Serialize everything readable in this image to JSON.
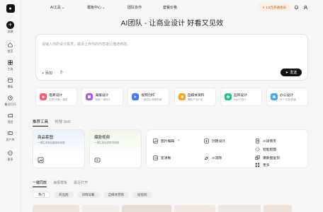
{
  "sidebar": {
    "create_label": "创建",
    "items": [
      {
        "label": "首页",
        "icon": "home-icon",
        "active": true
      },
      {
        "label": "工具",
        "icon": "tools-icon"
      },
      {
        "label": "模板",
        "icon": "template-icon"
      },
      {
        "label": "最近打开",
        "icon": "recent-icon"
      },
      {
        "label": "项目",
        "icon": "project-icon"
      },
      {
        "label": "资产库",
        "icon": "asset-icon"
      },
      {
        "label": "更多",
        "icon": "more-icon"
      }
    ]
  },
  "topnav": {
    "items": [
      "AI工具",
      "模板中心",
      "团队协作",
      "套餐价格"
    ],
    "vip_label": "1.5元开通会员",
    "accent": "#b2551b"
  },
  "headline": "AI团队 - 让商业设计 好看又见效",
  "prompt": {
    "placeholder": "请输入你的设计需求，或添上传你的内容进行描述修改。",
    "add_label": "添加",
    "send_label": "发送"
  },
  "categories": [
    {
      "title": "电商设计",
      "sub": "主图/详情/一键图",
      "color": "#ff5a6e",
      "icon": "shop-icon"
    },
    {
      "title": "海报设计",
      "sub": "海报/一键设计",
      "color": "#a85cf0",
      "icon": "poster-icon"
    },
    {
      "title": "视频创作",
      "sub": "一键成片/视频剪辑",
      "color": "#3d7cff",
      "icon": "video-icon"
    },
    {
      "title": "自媒体资料",
      "sub": "爆款/产品介绍",
      "color": "#f5a623",
      "icon": "media-icon"
    },
    {
      "title": "品牌设计",
      "sub": "logo/VI设计",
      "color": "#23c18b",
      "icon": "brand-icon"
    },
    {
      "title": "办公设计",
      "sub": "PPT/文档/表格",
      "color": "#3aa7ff",
      "icon": "office-icon"
    }
  ],
  "tools": {
    "tabs": [
      "推荐工具",
      "热搜 Skill"
    ],
    "big_cards": [
      {
        "title": "商品套图",
        "sub": "一键生成商品套图电商图"
      },
      {
        "title": "爆款视频",
        "sub": "一键生成优质带货视频"
      }
    ],
    "grid": [
      {
        "label": "图片编辑",
        "icon": "image-edit-icon"
      },
      {
        "label": "创建设计",
        "icon": "create-design-icon"
      },
      {
        "label": "AI详情页",
        "icon": "ai-detail-icon"
      },
      {
        "label": "智能抠图",
        "icon": "cutout-icon"
      },
      {
        "label": "变清晰",
        "icon": "sharpen-icon"
      },
      {
        "label": "AI消除",
        "icon": "erase-icon"
      },
      {
        "label": "爆款图复刻",
        "icon": "replicate-icon"
      },
      {
        "label": "更多",
        "icon": "grid-more-icon"
      }
    ]
  },
  "bottom": {
    "tabs": [
      "一键同款",
      "海报模板",
      "最近打开"
    ],
    "pills": [
      "热门",
      "商品图",
      "详情穿戴",
      "自媒体营销",
      "短视频"
    ]
  }
}
